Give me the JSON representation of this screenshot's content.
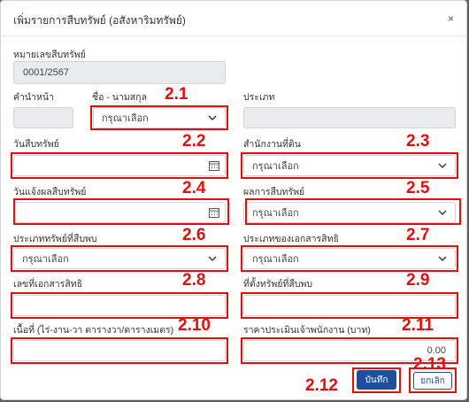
{
  "modal": {
    "title": "เพิ่มรายการสืบทรัพย์ (อสังหาริมทรัพย์)",
    "close_label": "×"
  },
  "fields": {
    "asset_no": {
      "label": "หมายเลขสืบทรัพย์",
      "value": "0001/2567"
    },
    "prefix": {
      "label": "คำนำหน้า",
      "value": ""
    },
    "fullname": {
      "label": "ชื่อ - นามสกุล",
      "value": "กรุณาเลือก"
    },
    "type": {
      "label": "ประเภท",
      "value": ""
    },
    "search_date": {
      "label": "วันสืบทรัพย์",
      "value": ""
    },
    "office": {
      "label": "สำนักงานที่ดิน",
      "value": "กรุณาเลือก"
    },
    "report_date": {
      "label": "วันแจ้งผลสืบทรัพย์",
      "value": ""
    },
    "result": {
      "label": "ผลการสืบทรัพย์",
      "value": "กรุณาเลือก"
    },
    "asset_type": {
      "label": "ประเภททรัพย์ที่สืบพบ",
      "value": "กรุณาเลือก"
    },
    "doc_type": {
      "label": "ประเภทของเอกสารสิทธิ",
      "value": "กรุณาเลือก"
    },
    "doc_no": {
      "label": "เลขที่เอกสารสิทธิ",
      "value": ""
    },
    "location": {
      "label": "ที่ตั้งทรัพย์ที่สืบพบ",
      "value": ""
    },
    "area": {
      "label": "เนื้อที่ (ไร่-งาน-วา ตารางวา/ตารางเมตร)",
      "value": ""
    },
    "price": {
      "label": "ราคาประเมินเจ้าพนักงาน (บาท)",
      "value": "0.00"
    }
  },
  "buttons": {
    "save": "บันทึก",
    "cancel": "ยกเลิก"
  },
  "annotations": {
    "n2_1": "2.1",
    "n2_2": "2.2",
    "n2_3": "2.3",
    "n2_4": "2.4",
    "n2_5": "2.5",
    "n2_6": "2.6",
    "n2_7": "2.7",
    "n2_8": "2.8",
    "n2_9": "2.9",
    "n2_10": "2.10",
    "n2_11": "2.11",
    "n2_12": "2.12",
    "n2_13": "2.13"
  },
  "colors": {
    "annotation": "#e01010",
    "primary": "#1f4e9c",
    "disabled_bg": "#e9ecef"
  },
  "icons": {
    "dropdown": "chevron-down-icon",
    "date": "calendar-icon",
    "close": "close-icon"
  }
}
